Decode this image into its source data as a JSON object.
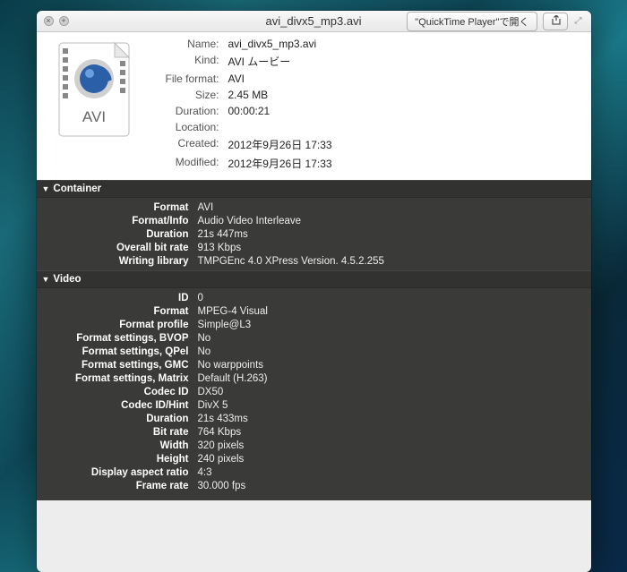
{
  "titlebar": {
    "title": "avi_divx5_mp3.avi",
    "open_with_label": "\"QuickTime Player\"で開く"
  },
  "summary": {
    "icon_badge": "AVI",
    "rows": [
      {
        "k": "Name:",
        "v": "avi_divx5_mp3.avi"
      },
      {
        "k": "Kind:",
        "v": "AVI ムービー"
      },
      {
        "k": "File format:",
        "v": "AVI"
      },
      {
        "k": "Size:",
        "v": "2.45 MB"
      },
      {
        "k": "Duration:",
        "v": "00:00:21"
      },
      {
        "k": "Location:",
        "v": ""
      },
      {
        "k": "Created:",
        "v": "2012年9月26日 17:33"
      },
      {
        "k": "Modified:",
        "v": "2012年9月26日 17:33"
      }
    ]
  },
  "sections": {
    "container": {
      "title": "Container",
      "rows": [
        {
          "k": "Format",
          "v": "AVI"
        },
        {
          "k": "Format/Info",
          "v": "Audio Video Interleave"
        },
        {
          "k": "Duration",
          "v": "21s 447ms"
        },
        {
          "k": "Overall bit rate",
          "v": "913 Kbps"
        },
        {
          "k": "Writing library",
          "v": "TMPGEnc 4.0 XPress Version. 4.5.2.255"
        }
      ]
    },
    "video": {
      "title": "Video",
      "rows": [
        {
          "k": "ID",
          "v": "0"
        },
        {
          "k": "Format",
          "v": "MPEG-4 Visual"
        },
        {
          "k": "Format profile",
          "v": "Simple@L3"
        },
        {
          "k": "Format settings, BVOP",
          "v": "No"
        },
        {
          "k": "Format settings, QPel",
          "v": "No"
        },
        {
          "k": "Format settings, GMC",
          "v": "No warppoints"
        },
        {
          "k": "Format settings, Matrix",
          "v": "Default (H.263)"
        },
        {
          "k": "Codec ID",
          "v": "DX50"
        },
        {
          "k": "Codec ID/Hint",
          "v": "DivX 5"
        },
        {
          "k": "Duration",
          "v": "21s 433ms"
        },
        {
          "k": "Bit rate",
          "v": "764 Kbps"
        },
        {
          "k": "Width",
          "v": "320 pixels"
        },
        {
          "k": "Height",
          "v": "240 pixels"
        },
        {
          "k": "Display aspect ratio",
          "v": "4:3"
        },
        {
          "k": "Frame rate",
          "v": "30.000 fps"
        }
      ]
    }
  }
}
